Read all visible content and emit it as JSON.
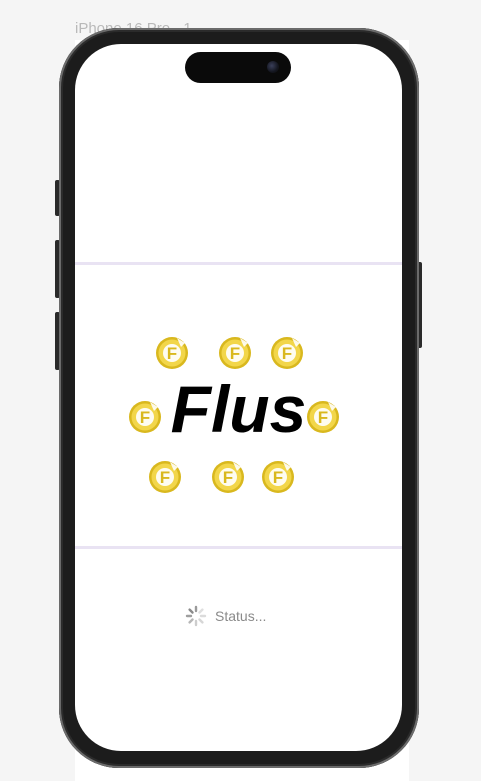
{
  "frame": {
    "label": "iPhone 16 Pro - 1"
  },
  "splash": {
    "logo_text": "Flus",
    "coin_letter": "F",
    "status_text": "Status..."
  },
  "colors": {
    "coin_gold": "#f2d64a",
    "coin_dark": "#d9b81e",
    "divider": "#e9e3f3",
    "status_text": "#8a8a8a"
  },
  "icons": {
    "coin": "coin-f-icon",
    "spinner": "loading-spinner-icon"
  }
}
